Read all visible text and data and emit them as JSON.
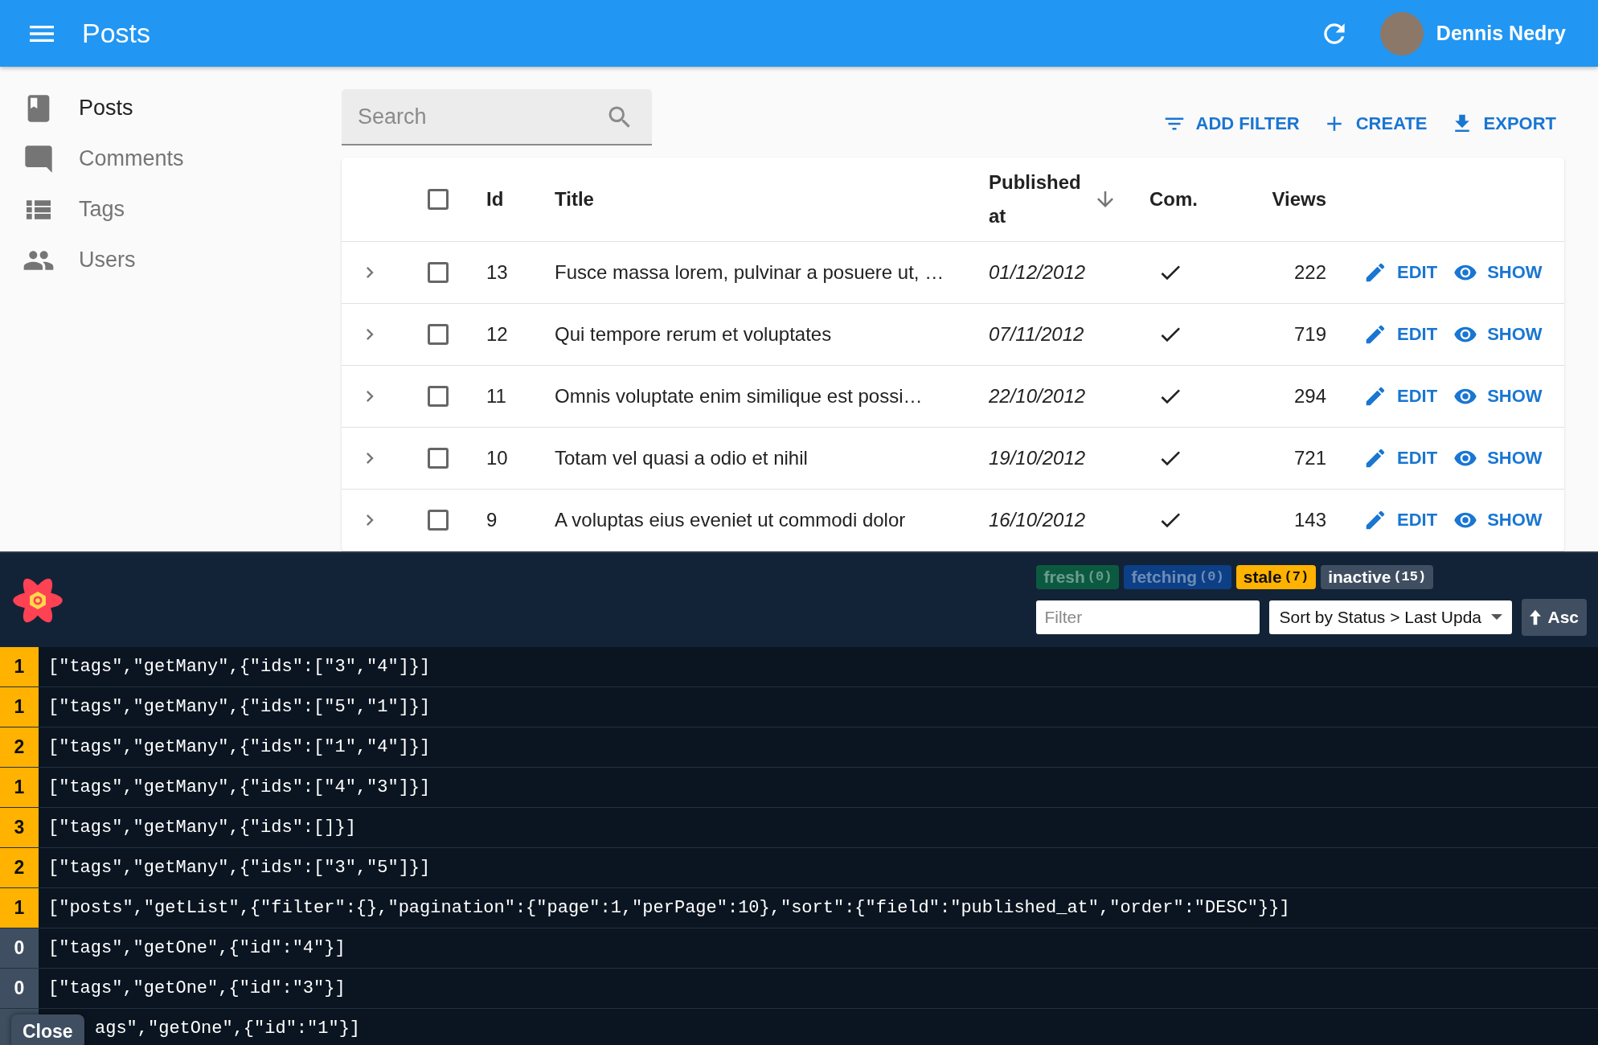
{
  "app_bar": {
    "title": "Posts",
    "user": "Dennis Nedry"
  },
  "sidebar": {
    "items": [
      {
        "label": "Posts",
        "selected": true
      },
      {
        "label": "Comments",
        "selected": false
      },
      {
        "label": "Tags",
        "selected": false
      },
      {
        "label": "Users",
        "selected": false
      }
    ]
  },
  "search": {
    "placeholder": "Search"
  },
  "toolbar": [
    {
      "label": "ADD FILTER"
    },
    {
      "label": "CREATE"
    },
    {
      "label": "EXPORT"
    }
  ],
  "table": {
    "select_all": {
      "checked": false
    },
    "columns": [
      {
        "label": "Id",
        "sorted": false
      },
      {
        "label": "Title",
        "sorted": false
      },
      {
        "label": "Published at",
        "sorted": true
      },
      {
        "label": "Com.",
        "sorted": false
      },
      {
        "label": "Views",
        "sorted": false
      }
    ],
    "rows": [
      {
        "expanded": false,
        "checked": false,
        "id": "13",
        "title": "Fusce massa lorem, pulvinar a posuere ut, …",
        "published_at": "01/12/2012",
        "commentable": true,
        "views": "222",
        "edit": "EDIT",
        "show": "SHOW"
      },
      {
        "expanded": false,
        "checked": false,
        "id": "12",
        "title": "Qui tempore rerum et voluptates",
        "published_at": "07/11/2012",
        "commentable": true,
        "views": "719",
        "edit": "EDIT",
        "show": "SHOW"
      },
      {
        "expanded": false,
        "checked": false,
        "id": "11",
        "title": "Omnis voluptate enim similique est possi…",
        "published_at": "22/10/2012",
        "commentable": true,
        "views": "294",
        "edit": "EDIT",
        "show": "SHOW"
      },
      {
        "expanded": false,
        "checked": false,
        "id": "10",
        "title": "Totam vel quasi a odio et nihil",
        "published_at": "19/10/2012",
        "commentable": true,
        "views": "721",
        "edit": "EDIT",
        "show": "SHOW"
      },
      {
        "expanded": false,
        "checked": false,
        "id": "9",
        "title": "A voluptas eius eveniet ut commodi dolor",
        "published_at": "16/10/2012",
        "commentable": true,
        "views": "143",
        "edit": "EDIT",
        "show": "SHOW"
      }
    ]
  },
  "devtools": {
    "status_filters": [
      {
        "label": "fresh",
        "count": "(0)",
        "color": "#0b5a40",
        "dimmed": true
      },
      {
        "label": "fetching",
        "count": "(0)",
        "color": "#0c3f86",
        "dimmed": true
      },
      {
        "label": "stale",
        "count": "(7)",
        "color": "#ffb200",
        "dimmed": false
      },
      {
        "label": "inactive",
        "count": "(15)",
        "color": "#3f4e60",
        "dimmed": false
      }
    ],
    "filter": {
      "placeholder": "Filter"
    },
    "sort": "Sort by Status > Last Upda",
    "order": "Asc",
    "queries": [
      {
        "count": "1",
        "color": "#ffb200",
        "key": "[\"tags\",\"getMany\",{\"ids\":[\"3\",\"4\"]}]"
      },
      {
        "count": "1",
        "color": "#ffb200",
        "key": "[\"tags\",\"getMany\",{\"ids\":[\"5\",\"1\"]}]"
      },
      {
        "count": "2",
        "color": "#ffb200",
        "key": "[\"tags\",\"getMany\",{\"ids\":[\"1\",\"4\"]}]"
      },
      {
        "count": "1",
        "color": "#ffb200",
        "key": "[\"tags\",\"getMany\",{\"ids\":[\"4\",\"3\"]}]"
      },
      {
        "count": "3",
        "color": "#ffb200",
        "key": "[\"tags\",\"getMany\",{\"ids\":[]}]"
      },
      {
        "count": "2",
        "color": "#ffb200",
        "key": "[\"tags\",\"getMany\",{\"ids\":[\"3\",\"5\"]}]"
      },
      {
        "count": "1",
        "color": "#ffb200",
        "key": "[\"posts\",\"getList\",{\"filter\":{},\"pagination\":{\"page\":1,\"perPage\":10},\"sort\":{\"field\":\"published_at\",\"order\":\"DESC\"}}]"
      },
      {
        "count": "0",
        "color": "#3f4e60",
        "key": "[\"tags\",\"getOne\",{\"id\":\"4\"}]"
      },
      {
        "count": "0",
        "color": "#3f4e60",
        "key": "[\"tags\",\"getOne\",{\"id\":\"3\"}]"
      },
      {
        "color": "#3f4e60",
        "key": "ags\",\"getOne\",{\"id\":\"1\"}]"
      }
    ],
    "close": "Close"
  }
}
